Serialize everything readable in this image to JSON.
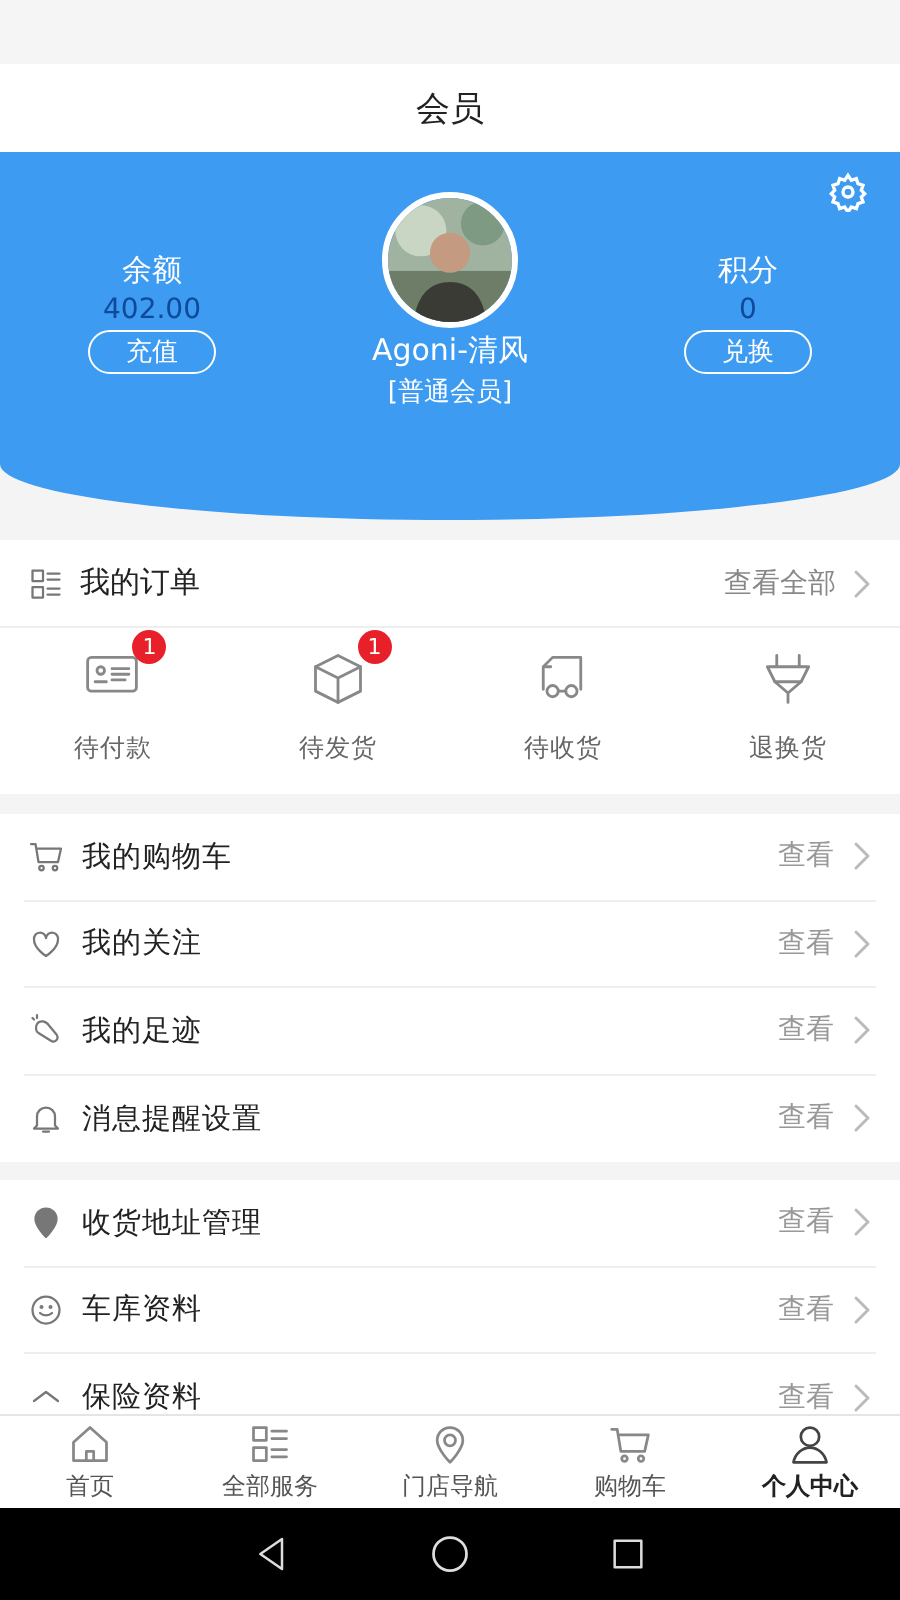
{
  "header": {
    "title": "会员"
  },
  "profile": {
    "balance_label": "余额",
    "balance": "402.00",
    "recharge": "充值",
    "name": "Agoni-清风",
    "level": "[普通会员]",
    "points_label": "积分",
    "points": "0",
    "exchange": "兑换"
  },
  "orders": {
    "title": "我的订单",
    "view_all": "查看全部",
    "items": [
      {
        "label": "待付款",
        "badge": "1",
        "kind": "card"
      },
      {
        "label": "待发货",
        "badge": "1",
        "kind": "box"
      },
      {
        "label": "待收货",
        "kind": "truck"
      },
      {
        "label": "退换货",
        "kind": "plug"
      }
    ]
  },
  "groups": [
    [
      {
        "label": "我的购物车",
        "action": "查看",
        "kind": "cart"
      },
      {
        "label": "我的关注",
        "action": "查看",
        "kind": "heart"
      },
      {
        "label": "我的足迹",
        "action": "查看",
        "kind": "foot"
      },
      {
        "label": "消息提醒设置",
        "action": "查看",
        "kind": "bell"
      }
    ],
    [
      {
        "label": "收货地址管理",
        "action": "查看",
        "kind": "pin"
      },
      {
        "label": "车库资料",
        "action": "查看",
        "kind": "smile"
      },
      {
        "label": "保险资料",
        "action": "查看",
        "kind": "shield"
      }
    ]
  ],
  "tabs": [
    {
      "label": "首页",
      "kind": "home",
      "selected": false
    },
    {
      "label": "全部服务",
      "kind": "grid",
      "selected": false
    },
    {
      "label": "门店导航",
      "kind": "pin",
      "selected": false
    },
    {
      "label": "购物车",
      "kind": "cart",
      "selected": false
    },
    {
      "label": "个人中心",
      "kind": "user",
      "selected": true
    }
  ]
}
